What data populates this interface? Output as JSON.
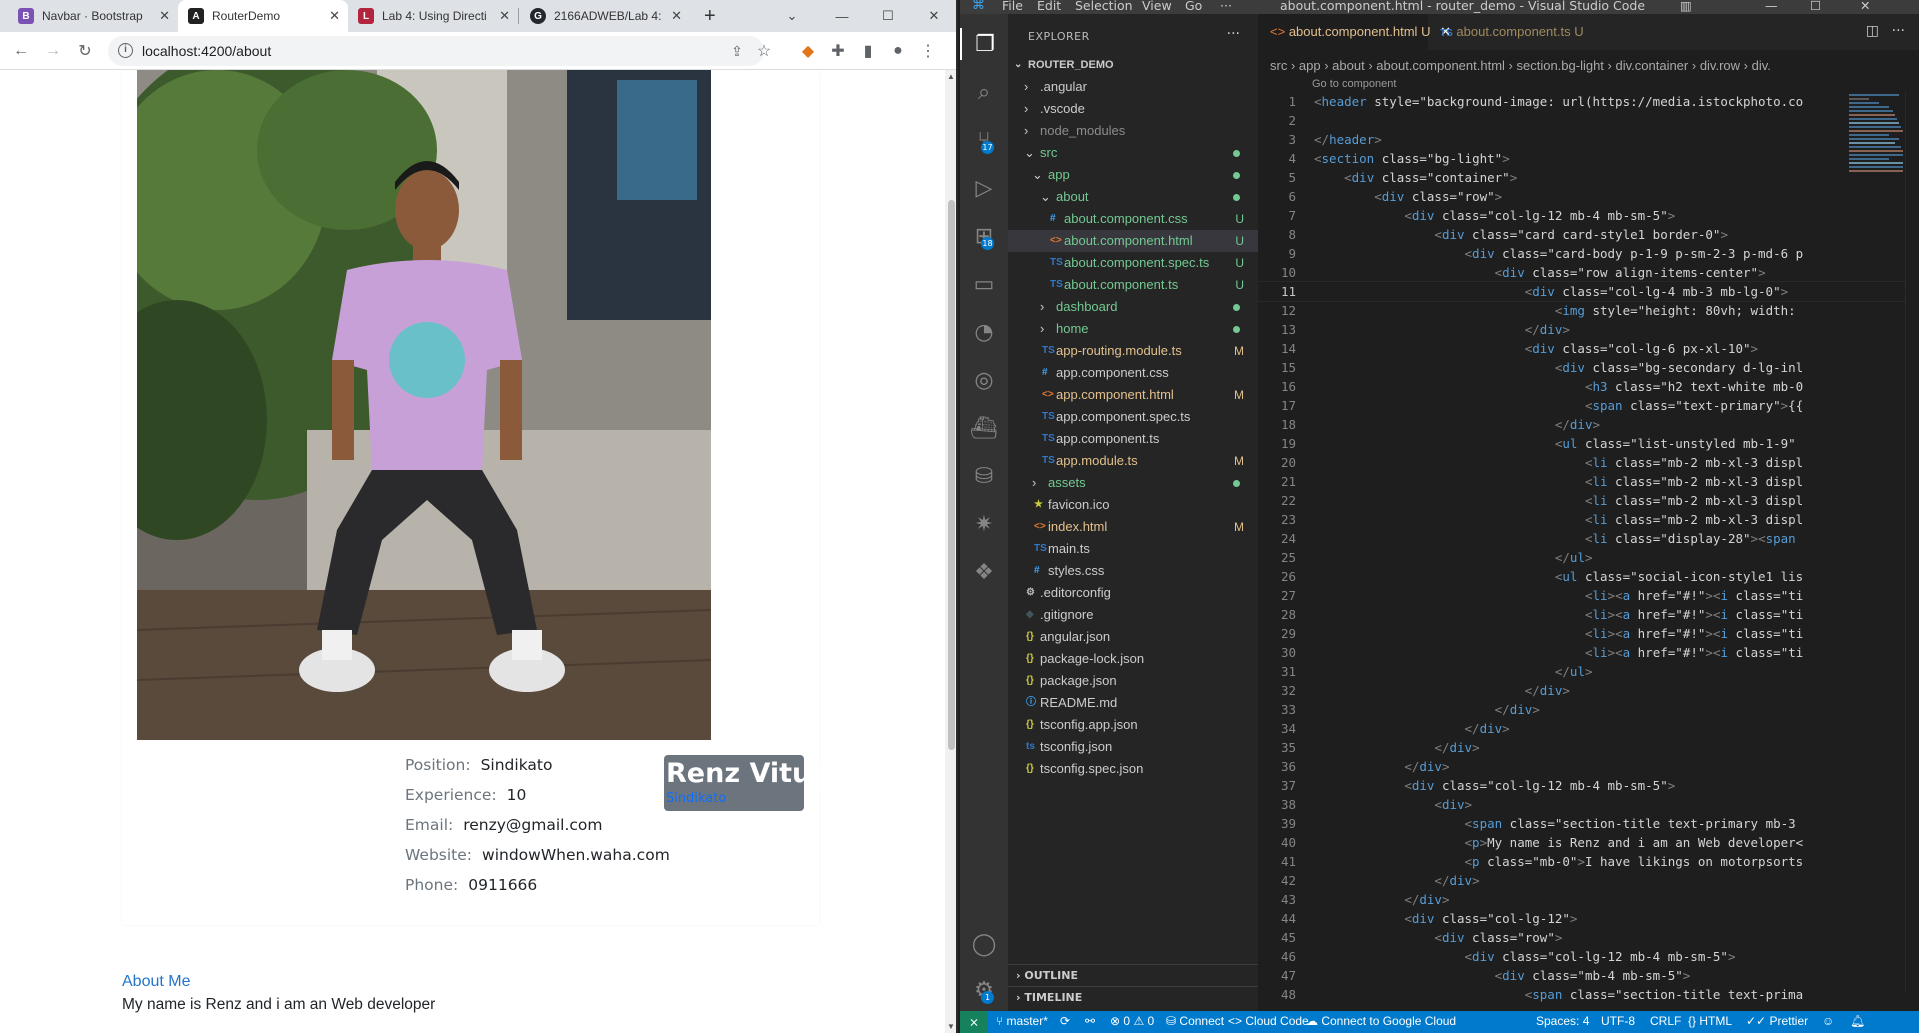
{
  "browser": {
    "tabs": [
      {
        "label": "Navbar · Bootstrap",
        "favicon": "B"
      },
      {
        "label": "RouterDemo",
        "favicon": "A"
      },
      {
        "label": "Lab 4: Using Directi",
        "favicon": "L"
      },
      {
        "label": "2166ADWEB/Lab 4:",
        "favicon": "G"
      }
    ],
    "url": "localhost:4200/about",
    "new_tab": "+"
  },
  "page": {
    "info": [
      {
        "label": "Position:",
        "value": "Sindikato"
      },
      {
        "label": "Experience:",
        "value": "10"
      },
      {
        "label": "Email:",
        "value": "renzy@gmail.com"
      },
      {
        "label": "Website:",
        "value": "windowWhen.waha.com"
      },
      {
        "label": "Phone:",
        "value": "0911666"
      }
    ],
    "name": "Renz Vitug",
    "name_position": "Sindikato",
    "about_title": "About Me",
    "about_text": "My name is Renz and i am an Web developer"
  },
  "vscode": {
    "menu": [
      "File",
      "Edit",
      "Selection",
      "View",
      "Go",
      "···"
    ],
    "title": "about.component.html - router_demo - Visual Studio Code",
    "explorer_header": "EXPLORER",
    "root": "ROUTER_DEMO",
    "tree": [
      {
        "name": ".angular",
        "depth": 1,
        "type": "folder",
        "open": false
      },
      {
        "name": ".vscode",
        "depth": 1,
        "type": "folder",
        "open": false
      },
      {
        "name": "node_modules",
        "depth": 1,
        "type": "folder",
        "open": false,
        "dim": true
      },
      {
        "name": "src",
        "depth": 1,
        "type": "folder",
        "open": true,
        "color": "#73c991",
        "dot": true
      },
      {
        "name": "app",
        "depth": 2,
        "type": "folder",
        "open": true,
        "color": "#73c991",
        "dot": true
      },
      {
        "name": "about",
        "depth": 3,
        "type": "folder",
        "open": true,
        "color": "#73c991",
        "dot": true
      },
      {
        "name": "about.component.css",
        "depth": 4,
        "type": "css",
        "color": "#73c991",
        "status": "U"
      },
      {
        "name": "about.component.html",
        "depth": 4,
        "type": "html",
        "color": "#73c991",
        "status": "U",
        "selected": true
      },
      {
        "name": "about.component.spec.ts",
        "depth": 4,
        "type": "ts",
        "color": "#73c991",
        "status": "U"
      },
      {
        "name": "about.component.ts",
        "depth": 4,
        "type": "ts",
        "color": "#73c991",
        "status": "U"
      },
      {
        "name": "dashboard",
        "depth": 3,
        "type": "folder",
        "open": false,
        "color": "#73c991",
        "dot": true
      },
      {
        "name": "home",
        "depth": 3,
        "type": "folder",
        "open": false,
        "color": "#73c991",
        "dot": true
      },
      {
        "name": "app-routing.module.ts",
        "depth": 3,
        "type": "ts",
        "color": "#e2c08d",
        "status": "M"
      },
      {
        "name": "app.component.css",
        "depth": 3,
        "type": "css"
      },
      {
        "name": "app.component.html",
        "depth": 3,
        "type": "html",
        "color": "#e2c08d",
        "status": "M"
      },
      {
        "name": "app.component.spec.ts",
        "depth": 3,
        "type": "ts"
      },
      {
        "name": "app.component.ts",
        "depth": 3,
        "type": "ts"
      },
      {
        "name": "app.module.ts",
        "depth": 3,
        "type": "ts",
        "color": "#e2c08d",
        "status": "M"
      },
      {
        "name": "assets",
        "depth": 2,
        "type": "folder",
        "open": false,
        "color": "#73c991",
        "dot": true
      },
      {
        "name": "favicon.ico",
        "depth": 2,
        "type": "star"
      },
      {
        "name": "index.html",
        "depth": 2,
        "type": "html",
        "color": "#e2c08d",
        "status": "M"
      },
      {
        "name": "main.ts",
        "depth": 2,
        "type": "ts"
      },
      {
        "name": "styles.css",
        "depth": 2,
        "type": "css"
      },
      {
        "name": ".editorconfig",
        "depth": 1,
        "type": "gear"
      },
      {
        "name": ".gitignore",
        "depth": 1,
        "type": "git"
      },
      {
        "name": "angular.json",
        "depth": 1,
        "type": "json"
      },
      {
        "name": "package-lock.json",
        "depth": 1,
        "type": "json"
      },
      {
        "name": "package.json",
        "depth": 1,
        "type": "json"
      },
      {
        "name": "README.md",
        "depth": 1,
        "type": "info"
      },
      {
        "name": "tsconfig.app.json",
        "depth": 1,
        "type": "json"
      },
      {
        "name": "tsconfig.json",
        "depth": 1,
        "type": "tsconfig"
      },
      {
        "name": "tsconfig.spec.json",
        "depth": 1,
        "type": "json"
      }
    ],
    "outline": "OUTLINE",
    "timeline": "TIMELINE",
    "tabs": [
      {
        "label": "about.component.html",
        "status": "U",
        "active": true
      },
      {
        "label": "about.component.ts",
        "status": "U",
        "active": false
      }
    ],
    "breadcrumbs": [
      "src",
      "app",
      "about",
      "about.component.html",
      "section.bg-light",
      "div.container",
      "div.row",
      "div."
    ],
    "goto": "Go to component",
    "current_line": 11,
    "code": [
      "<header style=\"background-image: url(https://media.istockphoto.co",
      "",
      "</header>",
      "<section class=\"bg-light\">",
      "    <div class=\"container\">",
      "        <div class=\"row\">",
      "            <div class=\"col-lg-12 mb-4 mb-sm-5\">",
      "                <div class=\"card card-style1 border-0\">",
      "                    <div class=\"card-body p-1-9 p-sm-2-3 p-md-6 p",
      "                        <div class=\"row align-items-center\">",
      "                            <div class=\"col-lg-4 mb-3 mb-lg-0\">",
      "                                <img style=\"height: 80vh; width:",
      "                            </div>",
      "                            <div class=\"col-lg-6 px-xl-10\">",
      "                                <div class=\"bg-secondary d-lg-inl",
      "                                    <h3 class=\"h2 text-white mb-0",
      "                                    <span class=\"text-primary\">{{",
      "                                </div>",
      "                                <ul class=\"list-unstyled mb-1-9\"",
      "                                    <li class=\"mb-2 mb-xl-3 displ",
      "                                    <li class=\"mb-2 mb-xl-3 displ",
      "                                    <li class=\"mb-2 mb-xl-3 displ",
      "                                    <li class=\"mb-2 mb-xl-3 displ",
      "                                    <li class=\"display-28\"><span",
      "                                </ul>",
      "                                <ul class=\"social-icon-style1 lis",
      "                                    <li><a href=\"#!\"><i class=\"ti",
      "                                    <li><a href=\"#!\"><i class=\"ti",
      "                                    <li><a href=\"#!\"><i class=\"ti",
      "                                    <li><a href=\"#!\"><i class=\"ti",
      "                                </ul>",
      "                            </div>",
      "                        </div>",
      "                    </div>",
      "                </div>",
      "            </div>",
      "            <div class=\"col-lg-12 mb-4 mb-sm-5\">",
      "                <div>",
      "                    <span class=\"section-title text-primary mb-3",
      "                    <p>My name is Renz and i am an Web developer<",
      "                    <p class=\"mb-0\">I have likings on motorpsorts",
      "                </div>",
      "            </div>",
      "            <div class=\"col-lg-12\">",
      "                <div class=\"row\">",
      "                    <div class=\"col-lg-12 mb-4 mb-sm-5\">",
      "                        <div class=\"mb-4 mb-sm-5\">",
      "                            <span class=\"section-title text-prima"
    ],
    "status": {
      "branch": "master*",
      "errors": "0",
      "warnings": "0",
      "connect": "Connect",
      "cloud_code": "Cloud Code",
      "google_cloud": "Connect to Google Cloud",
      "spaces": "Spaces: 4",
      "encoding": "UTF-8",
      "eol": "CRLF",
      "language": "HTML",
      "prettier": "Prettier"
    },
    "badges": {
      "scm": "17",
      "extensions": "18",
      "settings": "1"
    }
  }
}
